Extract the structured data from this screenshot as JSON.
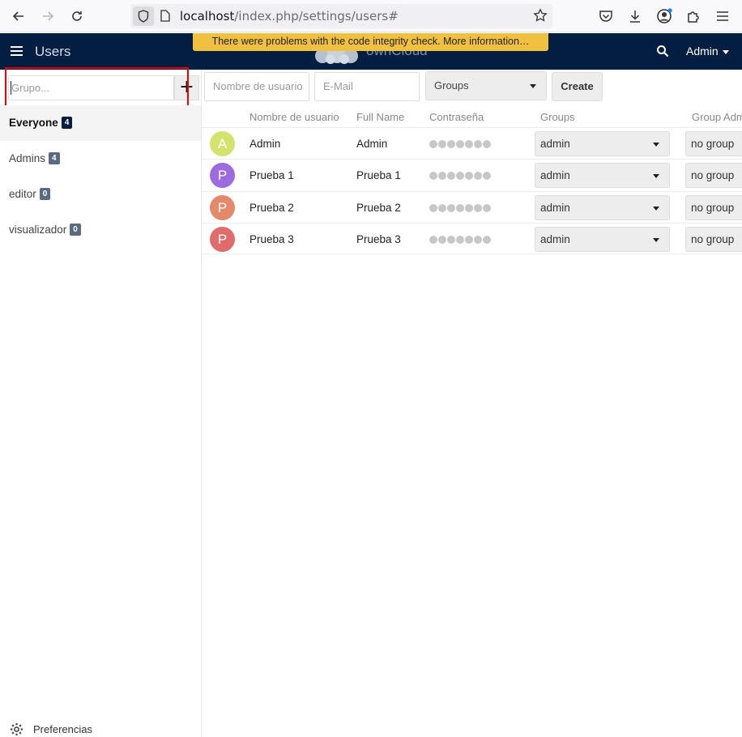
{
  "browser": {
    "url_host": "localhost",
    "url_path": "/index.php/settings/users#"
  },
  "header": {
    "app_title": "Users",
    "logo_text": "ownCloud",
    "warning": "There were problems with the code integrity check. More information…",
    "user_menu": "Admin"
  },
  "sidebar": {
    "group_placeholder": "Grupo...",
    "add_label": "+",
    "groups": [
      {
        "name": "Everyone",
        "count": "4"
      },
      {
        "name": "Admins",
        "count": "4"
      },
      {
        "name": "editor",
        "count": "0"
      },
      {
        "name": "visualizador",
        "count": "0"
      }
    ],
    "preferences": "Preferencias"
  },
  "create": {
    "username_placeholder": "Nombre de usuario",
    "email_placeholder": "E-Mail",
    "groups_label": "Groups",
    "create_label": "Create"
  },
  "table": {
    "headers": [
      "Nombre de usuario",
      "Full Name",
      "Contraseña",
      "Groups",
      "Group Admin"
    ],
    "rows": [
      {
        "initial": "A",
        "username": "Admin",
        "fullname": "Admin",
        "group": "admin",
        "group_admin": "no group",
        "avatar_color": "#d4e36e"
      },
      {
        "initial": "P",
        "username": "Prueba 1",
        "fullname": "Prueba 1",
        "group": "admin",
        "group_admin": "no group",
        "avatar_color": "#9d6be0"
      },
      {
        "initial": "P",
        "username": "Prueba 2",
        "fullname": "Prueba 2",
        "group": "admin",
        "group_admin": "no group",
        "avatar_color": "#e5896b"
      },
      {
        "initial": "P",
        "username": "Prueba 3",
        "fullname": "Prueba 3",
        "group": "admin",
        "group_admin": "no group",
        "avatar_color": "#e06b6b"
      }
    ]
  }
}
